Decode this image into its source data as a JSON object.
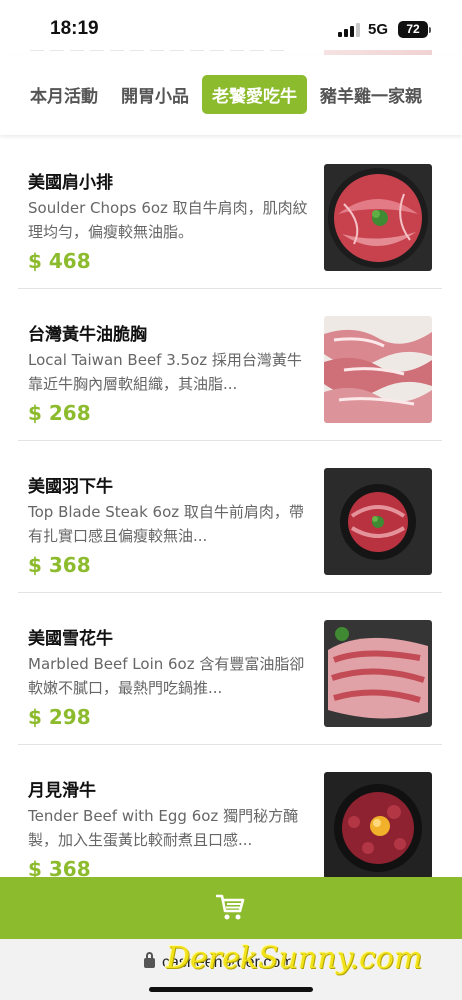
{
  "status_bar": {
    "time": "18:19",
    "network": "5G",
    "battery": "72"
  },
  "tabs": [
    {
      "label": "本月活動",
      "active": false
    },
    {
      "label": "開胃小品",
      "active": false
    },
    {
      "label": "老饕愛吃牛",
      "active": true
    },
    {
      "label": "豬羊雞一家親",
      "active": false
    }
  ],
  "menu_items": [
    {
      "name": "美國肩小排",
      "description": "Soulder Chops 6oz 取自牛肩肉，肌肉紋理均勻，偏瘦較無油脂。",
      "price": "$ 468",
      "image": "beef-shoulder-chops-plate"
    },
    {
      "name": "台灣黃牛油脆胸",
      "description": "Local Taiwan Beef 3.5oz 採用台灣黃牛靠近牛胸內層軟組織，其油脂...",
      "price": "$ 268",
      "image": "taiwan-beef-brisket-slices"
    },
    {
      "name": "美國羽下牛",
      "description": "Top Blade Steak 6oz 取自牛前肩肉，帶有扎實口感且偏瘦較無油...",
      "price": "$ 368",
      "image": "top-blade-steak-bowl"
    },
    {
      "name": "美國雪花牛",
      "description": "Marbled Beef Loin 6oz 含有豐富油脂卻軟嫩不膩口，最熱門吃鍋推...",
      "price": "$ 298",
      "image": "marbled-beef-loin-slices"
    },
    {
      "name": "月見滑牛",
      "description": "Tender Beef with Egg 6oz 獨門秘方醃製，加入生蛋黃比較耐煮且口感...",
      "price": "$ 368",
      "image": "tender-beef-with-egg-bowl"
    }
  ],
  "cart": {
    "icon": "cart-icon"
  },
  "browser": {
    "url": "casheenorder.com"
  },
  "watermark": "DerekSunny.com",
  "colors": {
    "accent": "#8dbb2e",
    "price": "#8dbb2e"
  }
}
